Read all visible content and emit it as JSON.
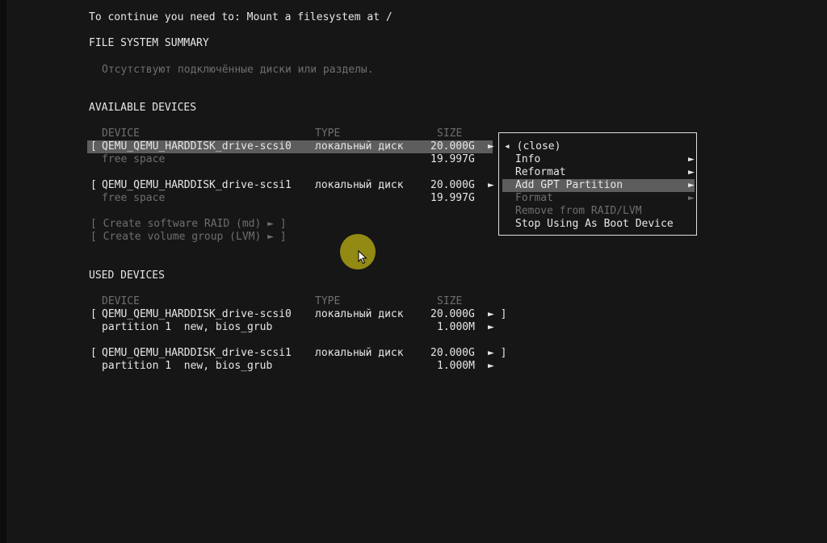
{
  "header": {
    "prompt": "To continue you need to: Mount a filesystem at /"
  },
  "fs_summary": {
    "title": "FILE SYSTEM SUMMARY",
    "empty_message": "Отсутствуют подключённые диски или разделы."
  },
  "columns": {
    "device": "DEVICE",
    "type": "TYPE",
    "size": "SIZE"
  },
  "arrow": "►",
  "available": {
    "title": "AVAILABLE DEVICES",
    "devices": [
      {
        "bracket": "[",
        "name": "QEMU_QEMU_HARDDISK_drive-scsi0",
        "type": "локальный диск",
        "size": "20.000G",
        "free_label": "free space",
        "free_size": "19.997G"
      },
      {
        "bracket": "[",
        "name": "QEMU_QEMU_HARDDISK_drive-scsi1",
        "type": "локальный диск",
        "size": "20.000G",
        "free_label": "free space",
        "free_size": "19.997G"
      }
    ],
    "create_raid": "[ Create software RAID (md) ► ]",
    "create_lvm": "[ Create volume group (LVM) ► ]"
  },
  "context_menu": {
    "close": "◂ (close)",
    "items": [
      {
        "label": "Info",
        "arrow": "►"
      },
      {
        "label": "Reformat",
        "arrow": "►"
      },
      {
        "label": "Add GPT Partition",
        "arrow": "►"
      },
      {
        "label": "Format",
        "arrow": "►"
      },
      {
        "label": "Remove from RAID/LVM",
        "arrow": ""
      },
      {
        "label": "Stop Using As Boot Device",
        "arrow": ""
      }
    ]
  },
  "used": {
    "title": "USED DEVICES",
    "devices": [
      {
        "bracket": "[",
        "name": "QEMU_QEMU_HARDDISK_drive-scsi0",
        "type": "локальный диск",
        "size": "20.000G",
        "end": "► ]",
        "partition": "partition 1  new, bios_grub",
        "partition_size": "1.000M",
        "partition_arrow": "►"
      },
      {
        "bracket": "[",
        "name": "QEMU_QEMU_HARDDISK_drive-scsi1",
        "type": "локальный диск",
        "size": "20.000G",
        "end": "► ]",
        "partition": "partition 1  new, bios_grub",
        "partition_size": "1.000M",
        "partition_arrow": "►"
      }
    ]
  }
}
